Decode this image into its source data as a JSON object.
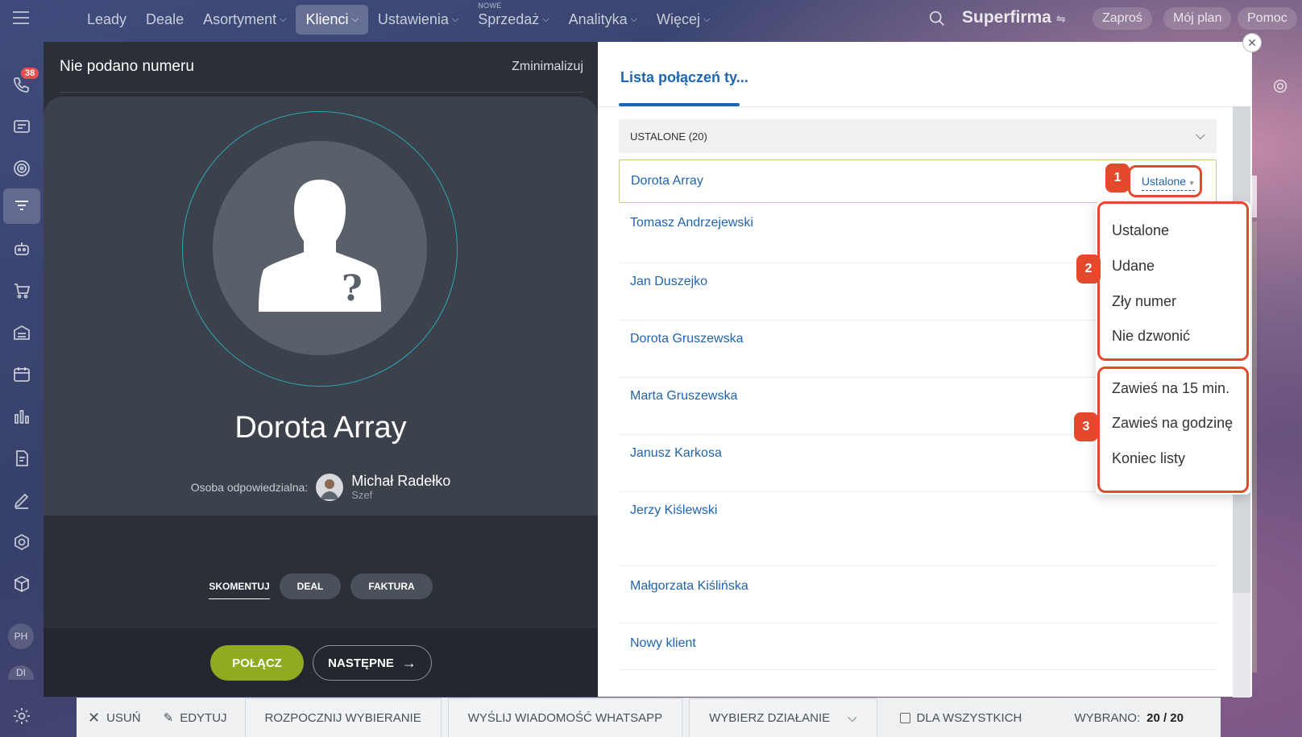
{
  "nav": {
    "items": [
      {
        "label": "Leady",
        "chevron": false
      },
      {
        "label": "Deale",
        "chevron": false
      },
      {
        "label": "Asortyment",
        "chevron": true
      },
      {
        "label": "Klienci",
        "chevron": true,
        "active": true
      },
      {
        "label": "Ustawienia",
        "chevron": true
      },
      {
        "label": "Sprzedaż",
        "chevron": true,
        "badge": "NOWE"
      },
      {
        "label": "Analityka",
        "chevron": true
      },
      {
        "label": "Więcej",
        "chevron": true
      }
    ],
    "brand": "Superfirma",
    "invite": "Zaproś",
    "plan": "Mój plan",
    "help": "Pomoc"
  },
  "sidebar": {
    "notification_count": "38",
    "avatar_1": "PH",
    "avatar_2": "DI"
  },
  "dialer": {
    "header_title": "Nie podano numeru",
    "minimize_label": "Zminimalizuj",
    "contact_name": "Dorota Array",
    "responsible_label": "Osoba odpowiedzialna:",
    "responsible_name": "Michał Radełko",
    "responsible_role": "Szef",
    "tab_comment": "SKOMENTUJ",
    "chip_deal": "DEAL",
    "chip_invoice": "FAKTURA",
    "call_button": "POŁĄCZ",
    "next_button": "NASTĘPNE"
  },
  "call_list": {
    "tab_label": "Lista połączeń ty...",
    "group_header": "USTALONE (20)",
    "selected_status": "Ustalone",
    "contacts": [
      "Dorota Array",
      "Tomasz Andrzejewski",
      "Jan Duszejko",
      "Dorota Gruszewska",
      "Marta Gruszewska",
      "Janusz Karkosa",
      "Jerzy Kiślewski",
      "Małgorzata Kiślińska",
      "Nowy klient"
    ]
  },
  "status_dropdown": {
    "status_options": [
      "Ustalone",
      "Udane",
      "Zły numer",
      "Nie dzwonić"
    ],
    "postpone_options": [
      "Zawieś na 15 min.",
      "Zawieś na godzinę",
      "Koniec listy"
    ]
  },
  "annotations": {
    "marker_1": "1",
    "marker_2": "2",
    "marker_3": "3",
    "highlight_color": "#e5492b"
  },
  "bottom_bar": {
    "delete": "USUŃ",
    "edit": "EDYTUJ",
    "start_dialing": "ROZPOCZNIJ WYBIERANIE",
    "send_whatsapp": "WYŚLIJ WIADOMOŚĆ WHATSAPP",
    "choose_action": "WYBIERZ DZIAŁANIE",
    "for_all": "DLA WSZYSTKICH",
    "selected_label": "WYBRANO:",
    "selected_count": "20 / 20"
  },
  "colors": {
    "accent_blue": "#1f63ad",
    "call_green": "#8fab1f",
    "dark_panel": "#2b3038"
  }
}
